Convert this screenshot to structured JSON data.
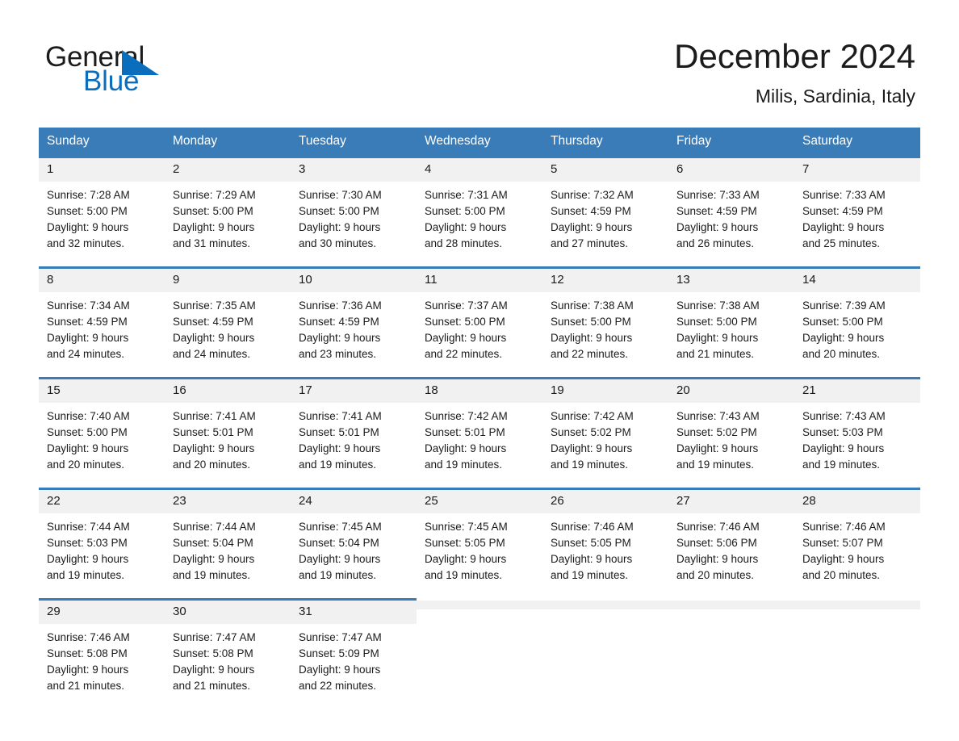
{
  "brand": {
    "line1": "General",
    "line2": "Blue",
    "logo_icon": "blue-triangle-icon"
  },
  "header": {
    "title": "December 2024",
    "location": "Milis, Sardinia, Italy"
  },
  "colors": {
    "header_blue": "#3a7cb8",
    "brand_blue": "#0a6ebd",
    "daynum_band": "#f1f1f1",
    "text": "#1b1b1b"
  },
  "weekday_headers": [
    "Sunday",
    "Monday",
    "Tuesday",
    "Wednesday",
    "Thursday",
    "Friday",
    "Saturday"
  ],
  "weeks": [
    [
      {
        "day": "1",
        "sunrise": "Sunrise: 7:28 AM",
        "sunset": "Sunset: 5:00 PM",
        "daylight1": "Daylight: 9 hours",
        "daylight2": "and 32 minutes."
      },
      {
        "day": "2",
        "sunrise": "Sunrise: 7:29 AM",
        "sunset": "Sunset: 5:00 PM",
        "daylight1": "Daylight: 9 hours",
        "daylight2": "and 31 minutes."
      },
      {
        "day": "3",
        "sunrise": "Sunrise: 7:30 AM",
        "sunset": "Sunset: 5:00 PM",
        "daylight1": "Daylight: 9 hours",
        "daylight2": "and 30 minutes."
      },
      {
        "day": "4",
        "sunrise": "Sunrise: 7:31 AM",
        "sunset": "Sunset: 5:00 PM",
        "daylight1": "Daylight: 9 hours",
        "daylight2": "and 28 minutes."
      },
      {
        "day": "5",
        "sunrise": "Sunrise: 7:32 AM",
        "sunset": "Sunset: 4:59 PM",
        "daylight1": "Daylight: 9 hours",
        "daylight2": "and 27 minutes."
      },
      {
        "day": "6",
        "sunrise": "Sunrise: 7:33 AM",
        "sunset": "Sunset: 4:59 PM",
        "daylight1": "Daylight: 9 hours",
        "daylight2": "and 26 minutes."
      },
      {
        "day": "7",
        "sunrise": "Sunrise: 7:33 AM",
        "sunset": "Sunset: 4:59 PM",
        "daylight1": "Daylight: 9 hours",
        "daylight2": "and 25 minutes."
      }
    ],
    [
      {
        "day": "8",
        "sunrise": "Sunrise: 7:34 AM",
        "sunset": "Sunset: 4:59 PM",
        "daylight1": "Daylight: 9 hours",
        "daylight2": "and 24 minutes."
      },
      {
        "day": "9",
        "sunrise": "Sunrise: 7:35 AM",
        "sunset": "Sunset: 4:59 PM",
        "daylight1": "Daylight: 9 hours",
        "daylight2": "and 24 minutes."
      },
      {
        "day": "10",
        "sunrise": "Sunrise: 7:36 AM",
        "sunset": "Sunset: 4:59 PM",
        "daylight1": "Daylight: 9 hours",
        "daylight2": "and 23 minutes."
      },
      {
        "day": "11",
        "sunrise": "Sunrise: 7:37 AM",
        "sunset": "Sunset: 5:00 PM",
        "daylight1": "Daylight: 9 hours",
        "daylight2": "and 22 minutes."
      },
      {
        "day": "12",
        "sunrise": "Sunrise: 7:38 AM",
        "sunset": "Sunset: 5:00 PM",
        "daylight1": "Daylight: 9 hours",
        "daylight2": "and 22 minutes."
      },
      {
        "day": "13",
        "sunrise": "Sunrise: 7:38 AM",
        "sunset": "Sunset: 5:00 PM",
        "daylight1": "Daylight: 9 hours",
        "daylight2": "and 21 minutes."
      },
      {
        "day": "14",
        "sunrise": "Sunrise: 7:39 AM",
        "sunset": "Sunset: 5:00 PM",
        "daylight1": "Daylight: 9 hours",
        "daylight2": "and 20 minutes."
      }
    ],
    [
      {
        "day": "15",
        "sunrise": "Sunrise: 7:40 AM",
        "sunset": "Sunset: 5:00 PM",
        "daylight1": "Daylight: 9 hours",
        "daylight2": "and 20 minutes."
      },
      {
        "day": "16",
        "sunrise": "Sunrise: 7:41 AM",
        "sunset": "Sunset: 5:01 PM",
        "daylight1": "Daylight: 9 hours",
        "daylight2": "and 20 minutes."
      },
      {
        "day": "17",
        "sunrise": "Sunrise: 7:41 AM",
        "sunset": "Sunset: 5:01 PM",
        "daylight1": "Daylight: 9 hours",
        "daylight2": "and 19 minutes."
      },
      {
        "day": "18",
        "sunrise": "Sunrise: 7:42 AM",
        "sunset": "Sunset: 5:01 PM",
        "daylight1": "Daylight: 9 hours",
        "daylight2": "and 19 minutes."
      },
      {
        "day": "19",
        "sunrise": "Sunrise: 7:42 AM",
        "sunset": "Sunset: 5:02 PM",
        "daylight1": "Daylight: 9 hours",
        "daylight2": "and 19 minutes."
      },
      {
        "day": "20",
        "sunrise": "Sunrise: 7:43 AM",
        "sunset": "Sunset: 5:02 PM",
        "daylight1": "Daylight: 9 hours",
        "daylight2": "and 19 minutes."
      },
      {
        "day": "21",
        "sunrise": "Sunrise: 7:43 AM",
        "sunset": "Sunset: 5:03 PM",
        "daylight1": "Daylight: 9 hours",
        "daylight2": "and 19 minutes."
      }
    ],
    [
      {
        "day": "22",
        "sunrise": "Sunrise: 7:44 AM",
        "sunset": "Sunset: 5:03 PM",
        "daylight1": "Daylight: 9 hours",
        "daylight2": "and 19 minutes."
      },
      {
        "day": "23",
        "sunrise": "Sunrise: 7:44 AM",
        "sunset": "Sunset: 5:04 PM",
        "daylight1": "Daylight: 9 hours",
        "daylight2": "and 19 minutes."
      },
      {
        "day": "24",
        "sunrise": "Sunrise: 7:45 AM",
        "sunset": "Sunset: 5:04 PM",
        "daylight1": "Daylight: 9 hours",
        "daylight2": "and 19 minutes."
      },
      {
        "day": "25",
        "sunrise": "Sunrise: 7:45 AM",
        "sunset": "Sunset: 5:05 PM",
        "daylight1": "Daylight: 9 hours",
        "daylight2": "and 19 minutes."
      },
      {
        "day": "26",
        "sunrise": "Sunrise: 7:46 AM",
        "sunset": "Sunset: 5:05 PM",
        "daylight1": "Daylight: 9 hours",
        "daylight2": "and 19 minutes."
      },
      {
        "day": "27",
        "sunrise": "Sunrise: 7:46 AM",
        "sunset": "Sunset: 5:06 PM",
        "daylight1": "Daylight: 9 hours",
        "daylight2": "and 20 minutes."
      },
      {
        "day": "28",
        "sunrise": "Sunrise: 7:46 AM",
        "sunset": "Sunset: 5:07 PM",
        "daylight1": "Daylight: 9 hours",
        "daylight2": "and 20 minutes."
      }
    ],
    [
      {
        "day": "29",
        "sunrise": "Sunrise: 7:46 AM",
        "sunset": "Sunset: 5:08 PM",
        "daylight1": "Daylight: 9 hours",
        "daylight2": "and 21 minutes."
      },
      {
        "day": "30",
        "sunrise": "Sunrise: 7:47 AM",
        "sunset": "Sunset: 5:08 PM",
        "daylight1": "Daylight: 9 hours",
        "daylight2": "and 21 minutes."
      },
      {
        "day": "31",
        "sunrise": "Sunrise: 7:47 AM",
        "sunset": "Sunset: 5:09 PM",
        "daylight1": "Daylight: 9 hours",
        "daylight2": "and 22 minutes."
      },
      null,
      null,
      null,
      null
    ]
  ]
}
